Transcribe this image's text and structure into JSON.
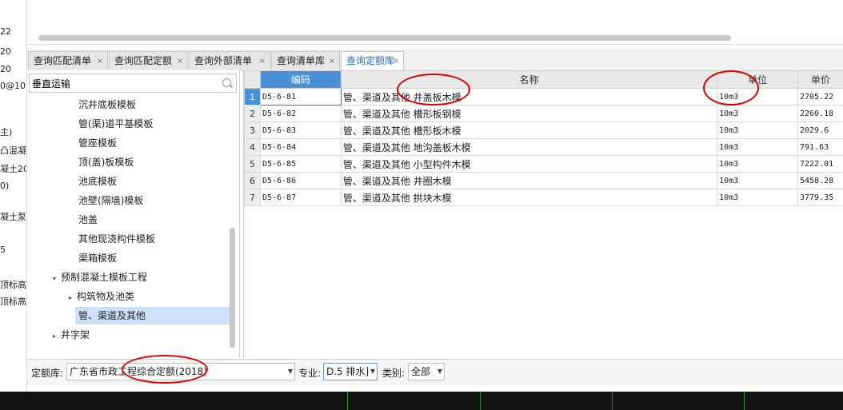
{
  "left_strip": [
    "22",
    "20",
    "20",
    "0@10",
    "主)",
    "凸混凝",
    "凝土20",
    "0)",
    "凝土泵",
    "5",
    "顶标高",
    "顶标高"
  ],
  "tabs": [
    {
      "label": "查询匹配清单",
      "active": false
    },
    {
      "label": "查询匹配定额",
      "active": false
    },
    {
      "label": "查询外部清单",
      "active": false
    },
    {
      "label": "查询清单库",
      "active": false
    },
    {
      "label": "查询定额库",
      "active": true
    }
  ],
  "tab_close": "×",
  "search": {
    "value": "垂直运输"
  },
  "tree": [
    {
      "label": "沉井底板模板",
      "level": 2,
      "arrow": "",
      "selected": false
    },
    {
      "label": "管(渠)道平基模板",
      "level": 2,
      "arrow": "",
      "selected": false
    },
    {
      "label": "管座模板",
      "level": 2,
      "arrow": "",
      "selected": false
    },
    {
      "label": "顶(盖)板模板",
      "level": 2,
      "arrow": "",
      "selected": false
    },
    {
      "label": "池底模板",
      "level": 2,
      "arrow": "",
      "selected": false
    },
    {
      "label": "池壁(隔墙)模板",
      "level": 2,
      "arrow": "",
      "selected": false
    },
    {
      "label": "池盖",
      "level": 2,
      "arrow": "",
      "selected": false
    },
    {
      "label": "其他现浇构件模板",
      "level": 2,
      "arrow": "",
      "selected": false
    },
    {
      "label": "渠箱模板",
      "level": 2,
      "arrow": "",
      "selected": false
    },
    {
      "label": "预制混凝土模板工程",
      "level": 1,
      "arrow": "▾",
      "selected": false
    },
    {
      "label": "构筑物及池类",
      "level": 2,
      "arrow": "▸",
      "selected": false
    },
    {
      "label": "管、渠道及其他",
      "level": 2,
      "arrow": "",
      "selected": true
    },
    {
      "label": "井字架",
      "level": 1,
      "arrow": "▸",
      "selected": false
    }
  ],
  "grid": {
    "headers": {
      "code": "编码",
      "name": "名称",
      "unit": "单位",
      "price": "单价"
    },
    "rows": [
      {
        "no": "1",
        "code": "D5-6-81",
        "name": "管、渠道及其他 井盖板木模",
        "unit": "10m3",
        "price": "2705.22"
      },
      {
        "no": "2",
        "code": "D5-6-82",
        "name": "管、渠道及其他 槽形板钢模",
        "unit": "10m3",
        "price": "2260.18"
      },
      {
        "no": "3",
        "code": "D5-6-83",
        "name": "管、渠道及其他 槽形板木模",
        "unit": "10m3",
        "price": "2029.6"
      },
      {
        "no": "4",
        "code": "D5-6-84",
        "name": "管、渠道及其他 地沟盖板木模",
        "unit": "10m3",
        "price": "791.63"
      },
      {
        "no": "5",
        "code": "D5-6-85",
        "name": "管、渠道及其他 小型构件木模",
        "unit": "10m3",
        "price": "7222.01"
      },
      {
        "no": "6",
        "code": "D5-6-86",
        "name": "管、渠道及其他 井圈木模",
        "unit": "10m3",
        "price": "5458.28"
      },
      {
        "no": "7",
        "code": "D5-6-87",
        "name": "管、渠道及其他 拱块木模",
        "unit": "10m3",
        "price": "3779.35"
      }
    ]
  },
  "bottom": {
    "library_label": "定额库:",
    "library_value": "广东省市政工程综合定额(2018)",
    "major_label": "专业:",
    "major_value": "D.5 排水]",
    "category_label": "类别:",
    "category_value": "全部"
  },
  "colors": {
    "accent": "#4a90d9",
    "highlight": "#e00000",
    "selected": "#cce0f7"
  }
}
